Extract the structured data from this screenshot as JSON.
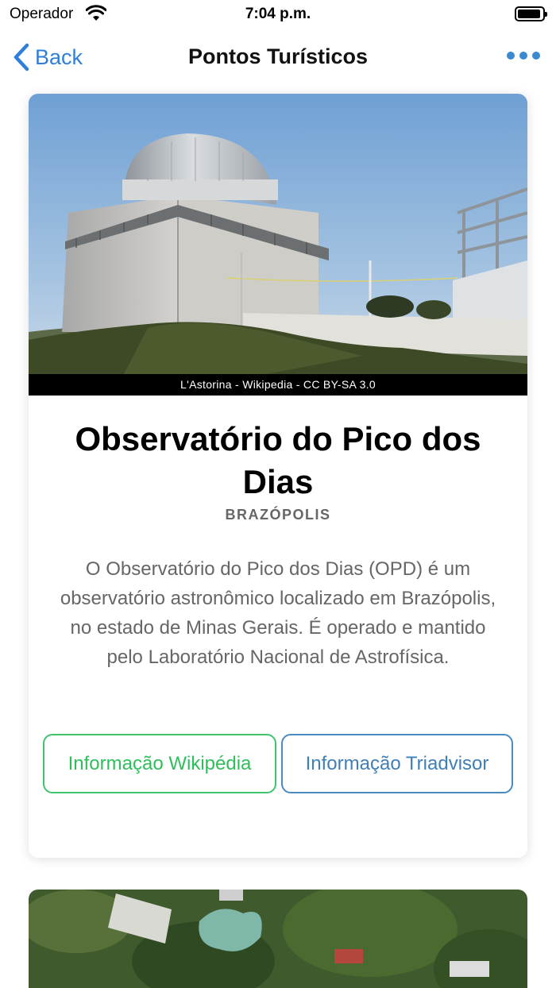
{
  "status": {
    "carrier": "Operador",
    "time": "7:04 p.m."
  },
  "nav": {
    "back_label": "Back",
    "title": "Pontos Turísticos"
  },
  "card": {
    "image_credit": "L'Astorina - Wikipedia - CC BY-SA 3.0",
    "title": "Observatório do Pico dos Dias",
    "city": "BRAZÓPOLIS",
    "description": "O Observatório do Pico dos Dias (OPD) é um observatório astronômico localizado em Brazópolis, no estado de Minas Gerais. É operado e mantido pelo Laboratório Nacional de Astrofísica.",
    "button_wikipedia": "Informação Wikipédia",
    "button_tripadvisor": "Informação Triadvisor"
  },
  "colors": {
    "accent_blue": "#2f7fd8",
    "wikipedia_green": "#2ebf5c",
    "tripadvisor_blue": "#3f7fb8"
  },
  "icons": [
    "wifi-icon",
    "battery-icon",
    "chevron-left-icon",
    "more-icon"
  ]
}
